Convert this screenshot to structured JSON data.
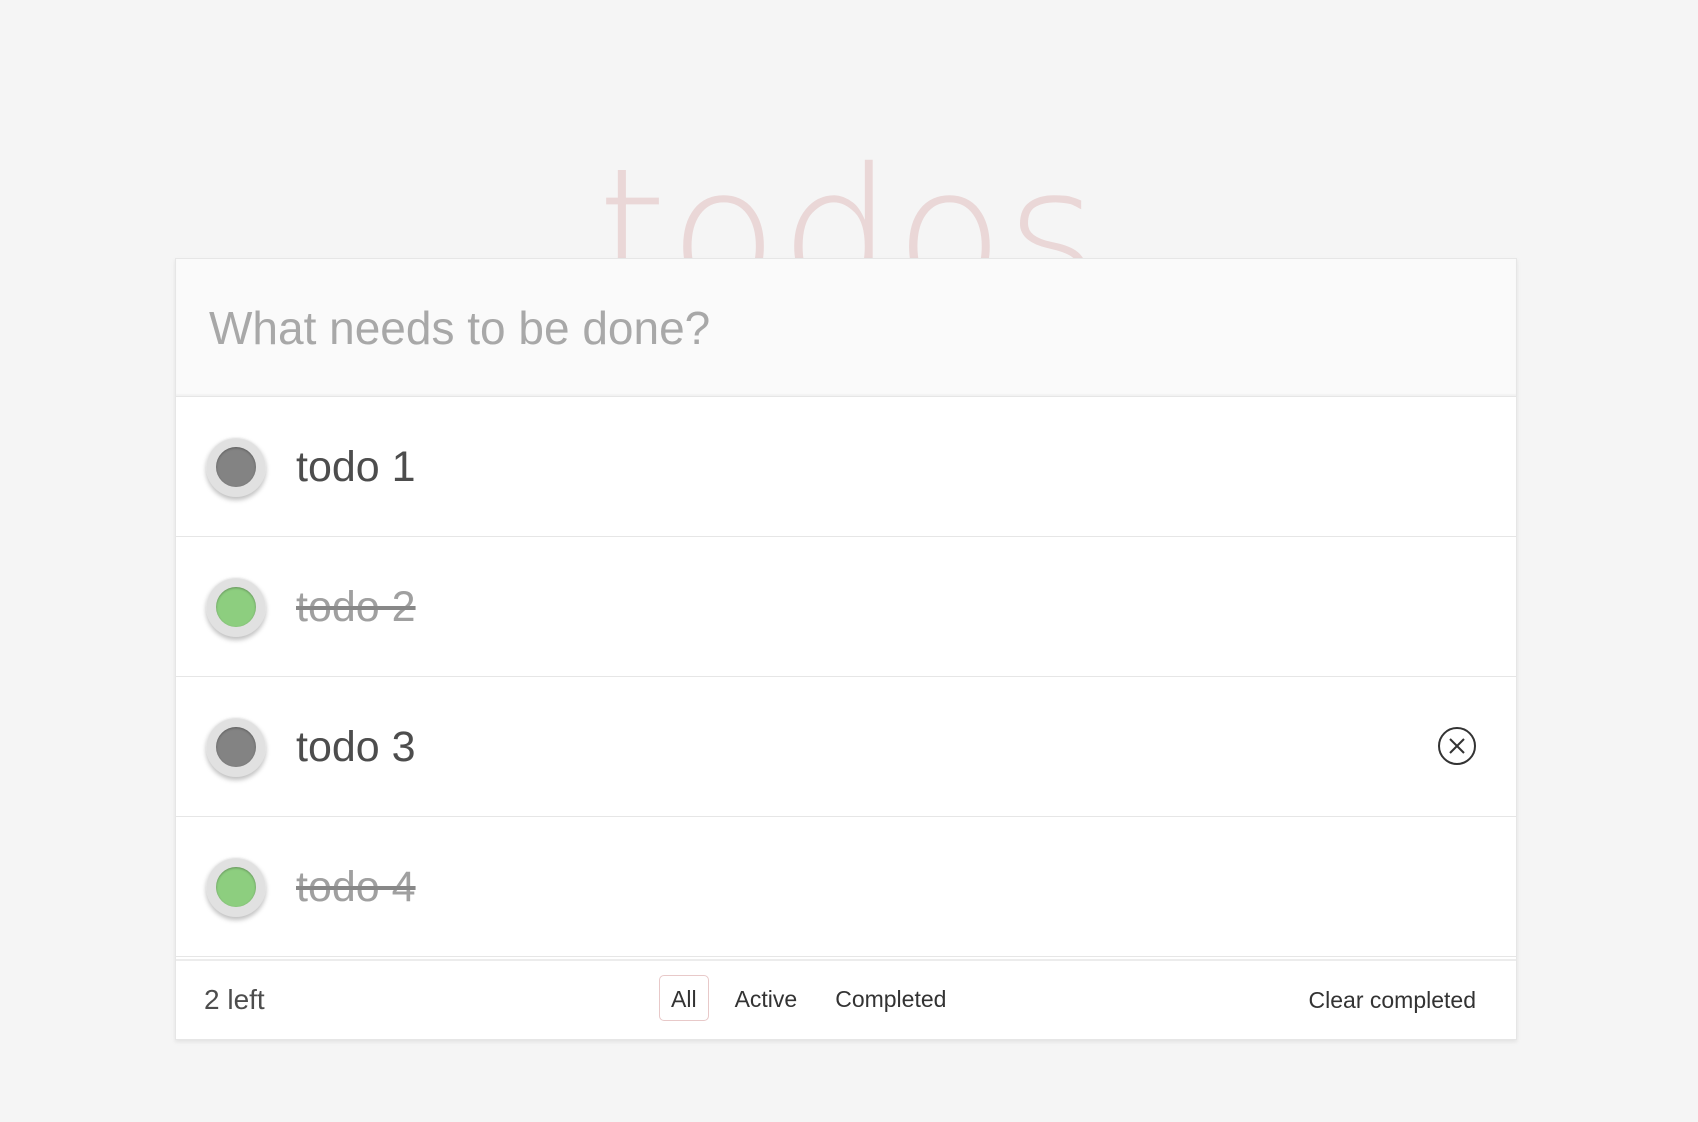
{
  "header": {
    "title": "todos"
  },
  "new_todo": {
    "placeholder": "What needs to be done?",
    "value": ""
  },
  "todos": [
    {
      "label": "todo 1",
      "completed": false
    },
    {
      "label": "todo 2",
      "completed": true
    },
    {
      "label": "todo 3",
      "completed": false
    },
    {
      "label": "todo 4",
      "completed": true
    }
  ],
  "footer": {
    "count_text": "2 left",
    "filters": [
      {
        "label": "All",
        "selected": true
      },
      {
        "label": "Active",
        "selected": false
      },
      {
        "label": "Completed",
        "selected": false
      }
    ],
    "clear_completed_label": "Clear completed"
  },
  "colors": {
    "title": "#ead7d7",
    "toggle_active": "#838383",
    "toggle_completed": "#8dce7f",
    "background": "#f5f5f5"
  },
  "icons": {
    "destroy": "close-circle-icon"
  }
}
